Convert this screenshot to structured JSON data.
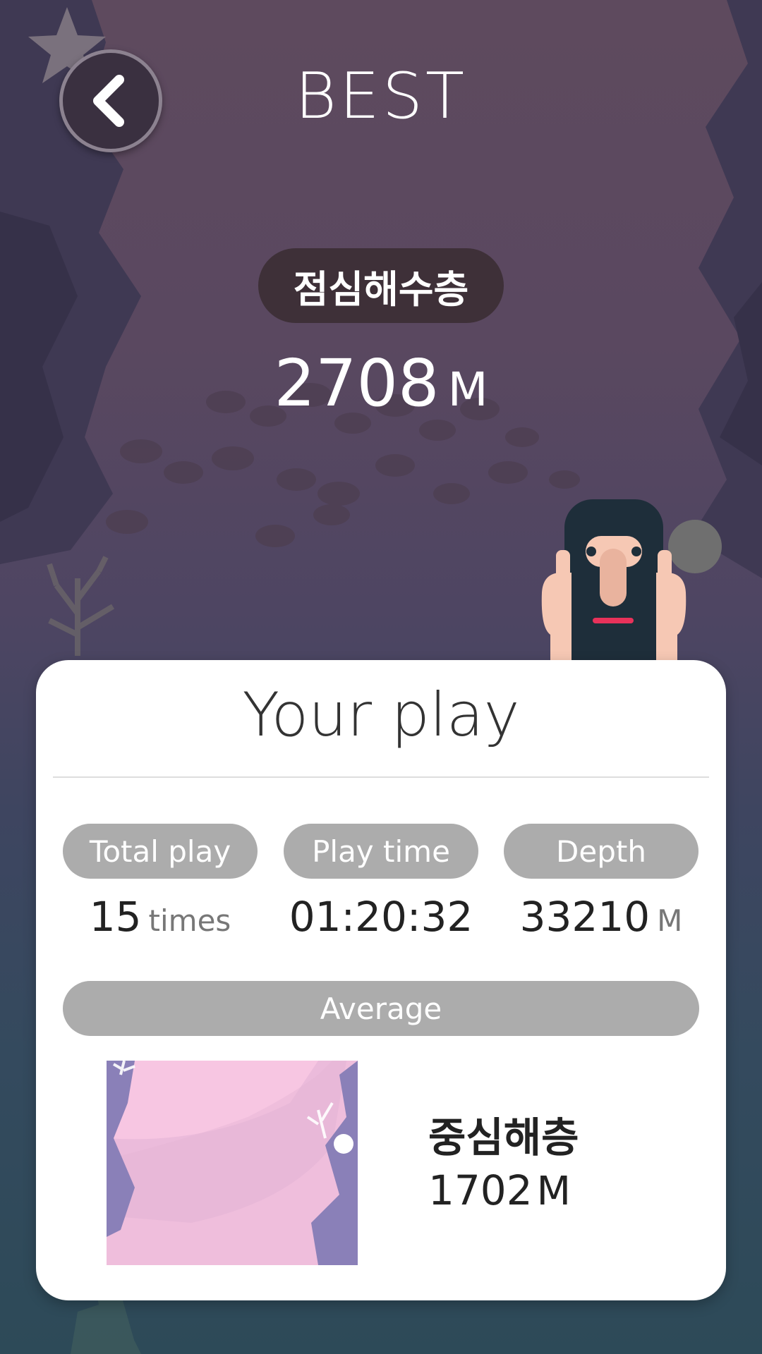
{
  "header": {
    "title": "BEST",
    "back_icon": "chevron-left-icon"
  },
  "best": {
    "zone": "점심해수층",
    "depth": "2708",
    "unit": "M"
  },
  "card": {
    "title": "Your play",
    "stats": [
      {
        "label": "Total play",
        "value": "15",
        "unit": "times"
      },
      {
        "label": "Play time",
        "value": "01:20:32",
        "unit": ""
      },
      {
        "label": "Depth",
        "value": "33210",
        "unit": "M"
      }
    ],
    "average": {
      "label": "Average",
      "zone": "중심해층",
      "depth": "1702",
      "unit": "M"
    }
  },
  "colors": {
    "pill": "#acacac",
    "badge": "#3e3038",
    "card": "#ffffff",
    "mascot_mouth": "#e8325a"
  }
}
